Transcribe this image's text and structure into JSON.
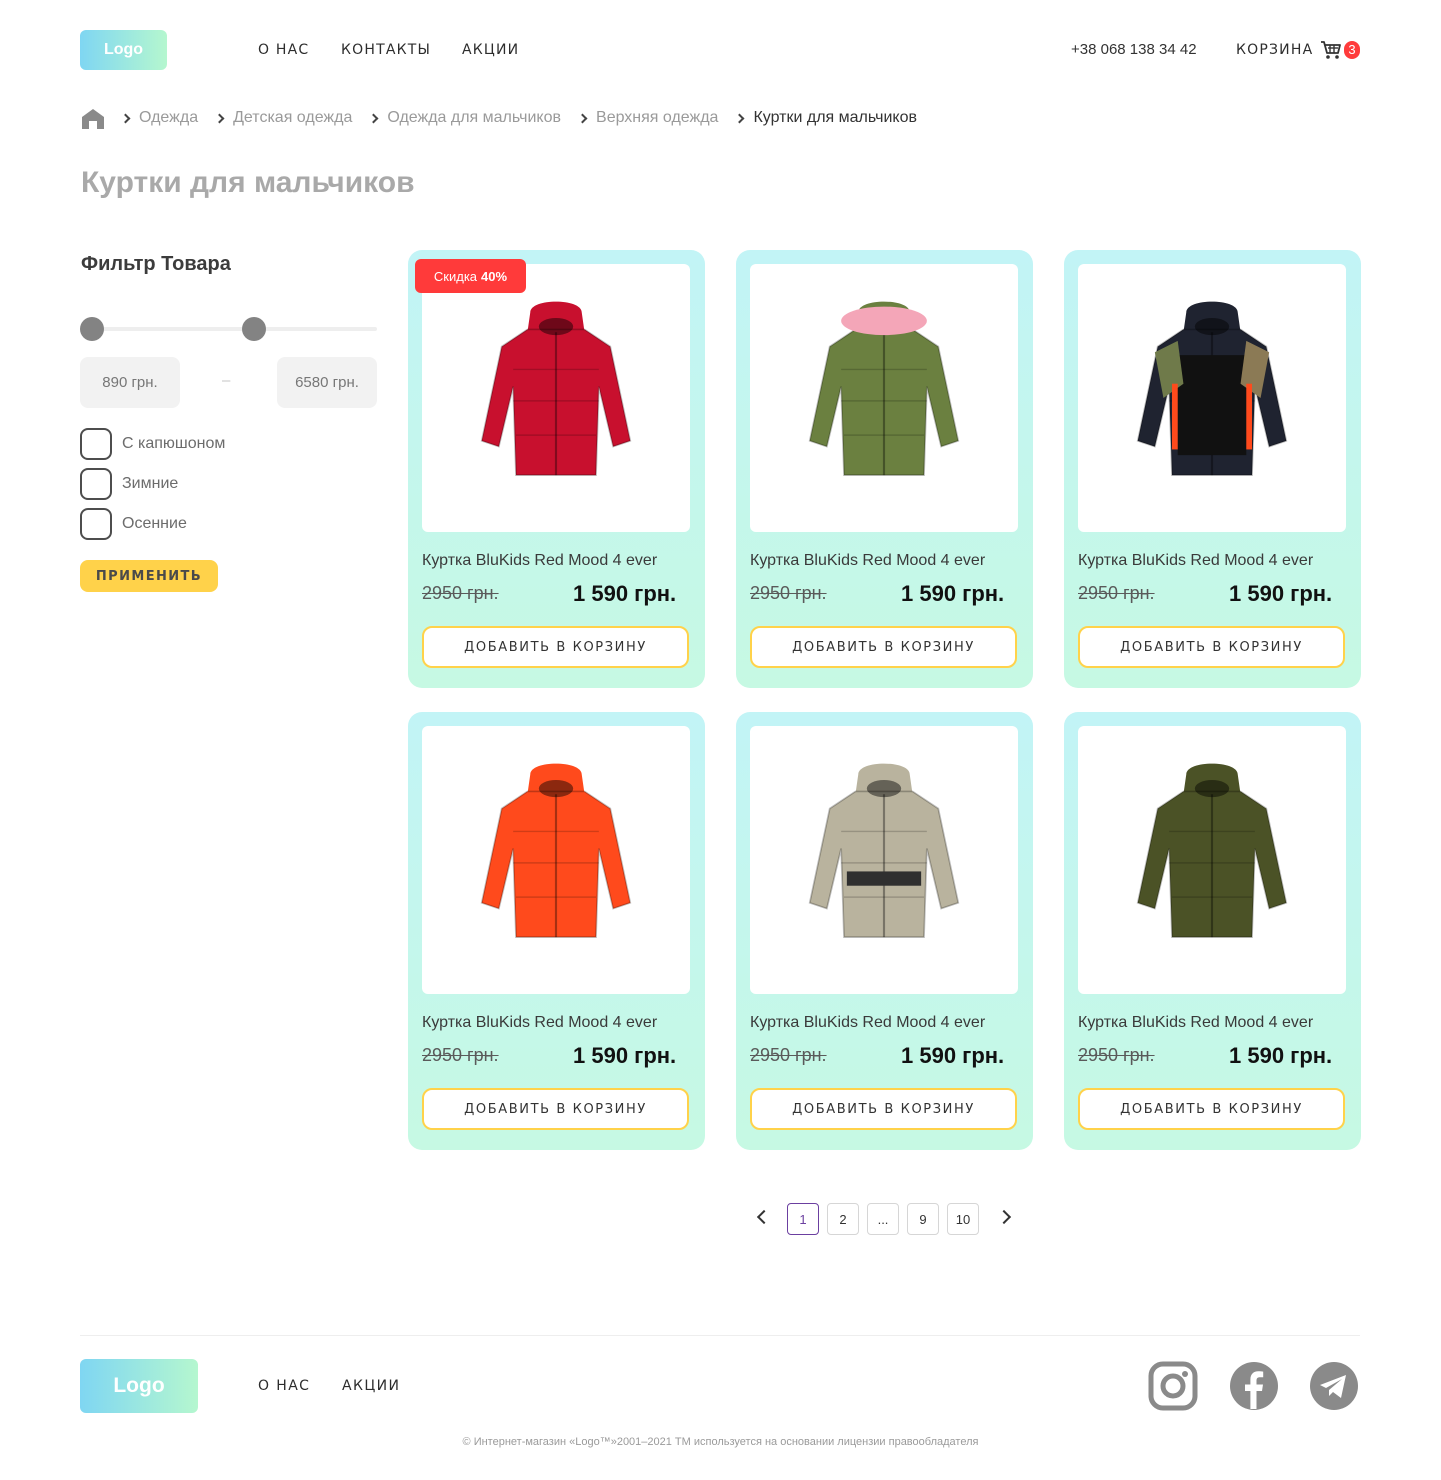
{
  "header": {
    "logo": "Logo",
    "nav": [
      "О НАС",
      "КОНТАКТЫ",
      "АКЦИИ"
    ],
    "phone": "+38 068 138 34 42",
    "cart_label": "КОРЗИНА",
    "cart_count": "3",
    "cart_icon": "cart-icon"
  },
  "breadcrumbs": {
    "home_icon": "home-icon",
    "items": [
      "Одежда",
      "Детская одежда",
      "Одежда для мальчиков",
      "Верхняя одежда",
      "Куртки для мальчиков"
    ]
  },
  "page_title": "Куртки для мальчиков",
  "filter": {
    "title": "Фильтр Товара",
    "price_min": "890 грн.",
    "price_max": "6580 грн.",
    "dash": "–",
    "slider_low": 0.0,
    "slider_high": 0.55,
    "checkboxes": [
      "С капюшоном",
      "Зимние",
      "Осенние"
    ],
    "apply_label": "ПРИМЕНИТЬ"
  },
  "discount_badge": {
    "text": "Скидка",
    "value": "40%"
  },
  "products": [
    {
      "name": "Куртка BluKids Red Mood 4 ever",
      "old_price": "2950 грн.",
      "price": "1 590 грн.",
      "button": "ДОБАВИТЬ В КОРЗИНУ",
      "image": "red-puffer-jacket",
      "color": "#c8102e"
    },
    {
      "name": "Куртка BluKids Red Mood 4 ever",
      "old_price": "2950 грн.",
      "price": "1 590 грн.",
      "button": "ДОБАВИТЬ В КОРЗИНУ",
      "image": "green-parka-pink-fur",
      "color": "#6b8040"
    },
    {
      "name": "Куртка BluKids Red Mood 4 ever",
      "old_price": "2950 грн.",
      "price": "1 590 грн.",
      "button": "ДОБАВИТЬ В КОРЗИНУ",
      "image": "camo-black-jacket",
      "color": "#1f2330"
    },
    {
      "name": "Куртка BluKids Red Mood 4 ever",
      "old_price": "2950 грн.",
      "price": "1 590 грн.",
      "button": "ДОБАВИТЬ В КОРЗИНУ",
      "image": "orange-puffer-jacket",
      "color": "#ff4a1c"
    },
    {
      "name": "Куртка BluKids Red Mood 4 ever",
      "old_price": "2950 грн.",
      "price": "1 590 грн.",
      "button": "ДОБАВИТЬ В КОРЗИНУ",
      "image": "beige-puffer-coat",
      "color": "#b9b39e"
    },
    {
      "name": "Куртка BluKids Red Mood 4 ever",
      "old_price": "2950 грн.",
      "price": "1 590 грн.",
      "button": "ДОБАВИТЬ В КОРЗИНУ",
      "image": "olive-puffer-jacket",
      "color": "#4b5226"
    }
  ],
  "pagination": {
    "pages": [
      "1",
      "2",
      "...",
      "9",
      "10"
    ],
    "active": "1"
  },
  "footer": {
    "logo": "Logo",
    "links": [
      "О НАС",
      "АКЦИИ"
    ],
    "social": [
      "instagram-icon",
      "facebook-icon",
      "telegram-icon"
    ],
    "copyright": "© Интернет-магазин «Logo™»2001–2021  ТМ используется на основании лицензии правообладателя"
  },
  "colors": {
    "accent": "#ffd24a",
    "badge": "#ff3a3a",
    "card_top": "#c2f4f6",
    "card_bottom": "#c6f9e3",
    "pager_active": "#6b3fa0"
  }
}
